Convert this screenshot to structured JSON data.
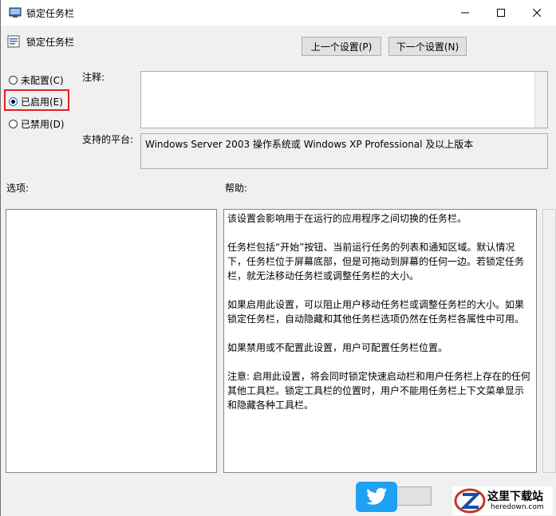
{
  "window": {
    "title": "锁定任务栏",
    "header_title": "锁定任务栏"
  },
  "nav": {
    "prev_label": "上一个设置(P)",
    "next_label": "下一个设置(N)"
  },
  "radios": [
    {
      "label": "未配置(C)",
      "checked": false
    },
    {
      "label": "已启用(E)",
      "checked": true
    },
    {
      "label": "已禁用(D)",
      "checked": false
    }
  ],
  "labels": {
    "comment": "注释:",
    "platform": "支持的平台:",
    "options": "选项:",
    "help": "帮助:"
  },
  "platform_text": "Windows Server 2003 操作系统或 Windows XP Professional 及以上版本",
  "help_paragraphs": [
    "该设置会影响用于在运行的应用程序之间切换的任务栏。",
    "任务栏包括“开始”按钮、当前运行任务的列表和通知区域。默认情况下，任务栏位于屏幕底部，但是可拖动到屏幕的任何一边。若锁定任务栏，就无法移动任务栏或调整任务栏的大小。",
    "如果启用此设置，可以阻止用户移动任务栏或调整任务栏的大小。如果锁定任务栏，自动隐藏和其他任务栏选项仍然在任务栏各属性中可用。",
    "如果禁用或不配置此设置，用户可配置任务栏位置。",
    "注意: 启用此设置，将会同时锁定快速启动栏和用户任务栏上存在的任何其他工具栏。锁定工具栏的位置时，用户不能用任务栏上下文菜单显示和隐藏各种工具栏。"
  ],
  "watermark": {
    "site_name": "这里下载站",
    "site_url": "heredown.com"
  },
  "colors": {
    "highlight": "#e02020",
    "accent": "#0078d7"
  }
}
